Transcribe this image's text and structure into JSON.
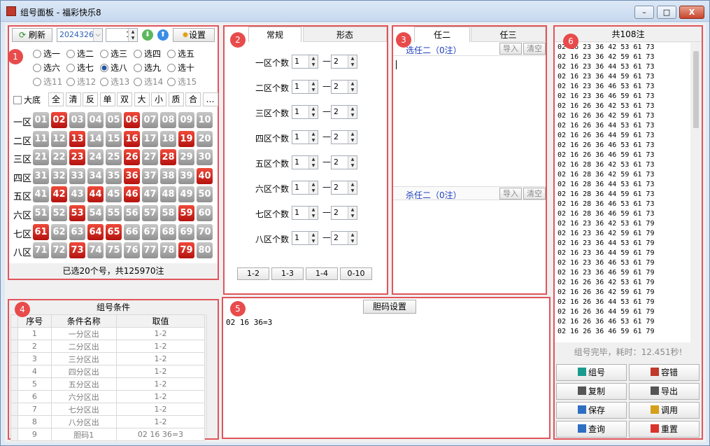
{
  "window": {
    "title": "组号面板 - 福彩快乐8",
    "min": "–",
    "max": "□",
    "close": "X"
  },
  "p1": {
    "refresh": "刷新",
    "issue": "2024326",
    "spin_value": "1",
    "settings": "设置",
    "picks": [
      "选一",
      "选二",
      "选三",
      "选四",
      "选五",
      "选六",
      "选七",
      "选八",
      "选九",
      "选十",
      "选11",
      "选12",
      "选13",
      "选14",
      "选15"
    ],
    "selected_pick": "选八",
    "big_base": "大底",
    "tools": [
      "全",
      "清",
      "反",
      "单",
      "双",
      "大",
      "小",
      "质",
      "合",
      "…"
    ],
    "zones": [
      {
        "label": "一区",
        "nums": [
          "01",
          "02",
          "03",
          "04",
          "05",
          "06",
          "07",
          "08",
          "09",
          "10"
        ],
        "sel": [
          "02",
          "06"
        ]
      },
      {
        "label": "二区",
        "nums": [
          "11",
          "12",
          "13",
          "14",
          "15",
          "16",
          "17",
          "18",
          "19",
          "20"
        ],
        "sel": [
          "13",
          "16",
          "19"
        ]
      },
      {
        "label": "三区",
        "nums": [
          "21",
          "22",
          "23",
          "24",
          "25",
          "26",
          "27",
          "28",
          "29",
          "30"
        ],
        "sel": [
          "23",
          "26",
          "28"
        ]
      },
      {
        "label": "四区",
        "nums": [
          "31",
          "32",
          "33",
          "34",
          "35",
          "36",
          "37",
          "38",
          "39",
          "40"
        ],
        "sel": [
          "36",
          "40"
        ]
      },
      {
        "label": "五区",
        "nums": [
          "41",
          "42",
          "43",
          "44",
          "45",
          "46",
          "47",
          "48",
          "49",
          "50"
        ],
        "sel": [
          "42",
          "44",
          "46"
        ]
      },
      {
        "label": "六区",
        "nums": [
          "51",
          "52",
          "53",
          "54",
          "55",
          "56",
          "57",
          "58",
          "59",
          "60"
        ],
        "sel": [
          "53",
          "59"
        ]
      },
      {
        "label": "七区",
        "nums": [
          "61",
          "62",
          "63",
          "64",
          "65",
          "66",
          "67",
          "68",
          "69",
          "70"
        ],
        "sel": [
          "61",
          "64",
          "65"
        ]
      },
      {
        "label": "八区",
        "nums": [
          "71",
          "72",
          "73",
          "74",
          "75",
          "76",
          "77",
          "78",
          "79",
          "80"
        ],
        "sel": [
          "73",
          "79"
        ]
      }
    ],
    "status": "已选20个号，共125970注"
  },
  "p2": {
    "tabs": [
      "常规",
      "形态"
    ],
    "rows": [
      {
        "label": "一区个数",
        "min": "1",
        "max": "2"
      },
      {
        "label": "二区个数",
        "min": "1",
        "max": "2"
      },
      {
        "label": "三区个数",
        "min": "1",
        "max": "2"
      },
      {
        "label": "四区个数",
        "min": "1",
        "max": "2"
      },
      {
        "label": "五区个数",
        "min": "1",
        "max": "2"
      },
      {
        "label": "六区个数",
        "min": "1",
        "max": "2"
      },
      {
        "label": "七区个数",
        "min": "1",
        "max": "2"
      },
      {
        "label": "八区个数",
        "min": "1",
        "max": "2"
      }
    ],
    "dash": "—",
    "range_buttons": [
      "1-2",
      "1-3",
      "1-4",
      "0-10"
    ]
  },
  "p3": {
    "tabs": [
      "任二",
      "任三"
    ],
    "pick_label": "选任二（0注）",
    "kill_label": "杀任二（0注）",
    "import": "导入",
    "clear": "清空"
  },
  "p4": {
    "title": "组号条件",
    "headers": [
      "序号",
      "条件名称",
      "取值"
    ],
    "rows": [
      [
        "1",
        "一分区出",
        "1-2"
      ],
      [
        "2",
        "二分区出",
        "1-2"
      ],
      [
        "3",
        "三分区出",
        "1-2"
      ],
      [
        "4",
        "四分区出",
        "1-2"
      ],
      [
        "5",
        "五分区出",
        "1-2"
      ],
      [
        "6",
        "六分区出",
        "1-2"
      ],
      [
        "7",
        "七分区出",
        "1-2"
      ],
      [
        "8",
        "八分区出",
        "1-2"
      ],
      [
        "9",
        "胆码1",
        "02 16 36=3"
      ]
    ]
  },
  "p5": {
    "button": "胆码设置",
    "content": "02 16 36=3"
  },
  "p6": {
    "title": "共108注",
    "lines": [
      "02 16 23 36 42 53 61 73",
      "02 16 23 36 42 59 61 73",
      "02 16 23 36 44 53 61 73",
      "02 16 23 36 44 59 61 73",
      "02 16 23 36 46 53 61 73",
      "02 16 23 36 46 59 61 73",
      "02 16 26 36 42 53 61 73",
      "02 16 26 36 42 59 61 73",
      "02 16 26 36 44 53 61 73",
      "02 16 26 36 44 59 61 73",
      "02 16 26 36 46 53 61 73",
      "02 16 26 36 46 59 61 73",
      "02 16 28 36 42 53 61 73",
      "02 16 28 36 42 59 61 73",
      "02 16 28 36 44 53 61 73",
      "02 16 28 36 44 59 61 73",
      "02 16 28 36 46 53 61 73",
      "02 16 28 36 46 59 61 73",
      "02 16 23 36 42 53 61 79",
      "02 16 23 36 42 59 61 79",
      "02 16 23 36 44 53 61 79",
      "02 16 23 36 44 59 61 79",
      "02 16 23 36 46 53 61 79",
      "02 16 23 36 46 59 61 79",
      "02 16 26 36 42 53 61 79",
      "02 16 26 36 42 59 61 79",
      "02 16 26 36 44 53 61 79",
      "02 16 26 36 44 59 61 79",
      "02 16 26 36 46 53 61 79",
      "02 16 26 36 46 59 61 79"
    ],
    "status": "组号完毕，耗时：12.451秒!",
    "actions": [
      {
        "label": "组号",
        "color": "#1a9b8f"
      },
      {
        "label": "容错",
        "color": "#c0392b"
      },
      {
        "label": "复制",
        "color": "#555555"
      },
      {
        "label": "导出",
        "color": "#555555"
      },
      {
        "label": "保存",
        "color": "#2e6fc2"
      },
      {
        "label": "调用",
        "color": "#d4a017"
      },
      {
        "label": "查询",
        "color": "#2e6fc2"
      },
      {
        "label": "重置",
        "color": "#d9342b"
      }
    ]
  },
  "badges": [
    "1",
    "2",
    "3",
    "4",
    "5",
    "6"
  ],
  "colors": {
    "accent": "#e0555c",
    "selected_ball": "#d62a1f",
    "ball": "#a8a8a8",
    "link": "#1f3fbf"
  }
}
